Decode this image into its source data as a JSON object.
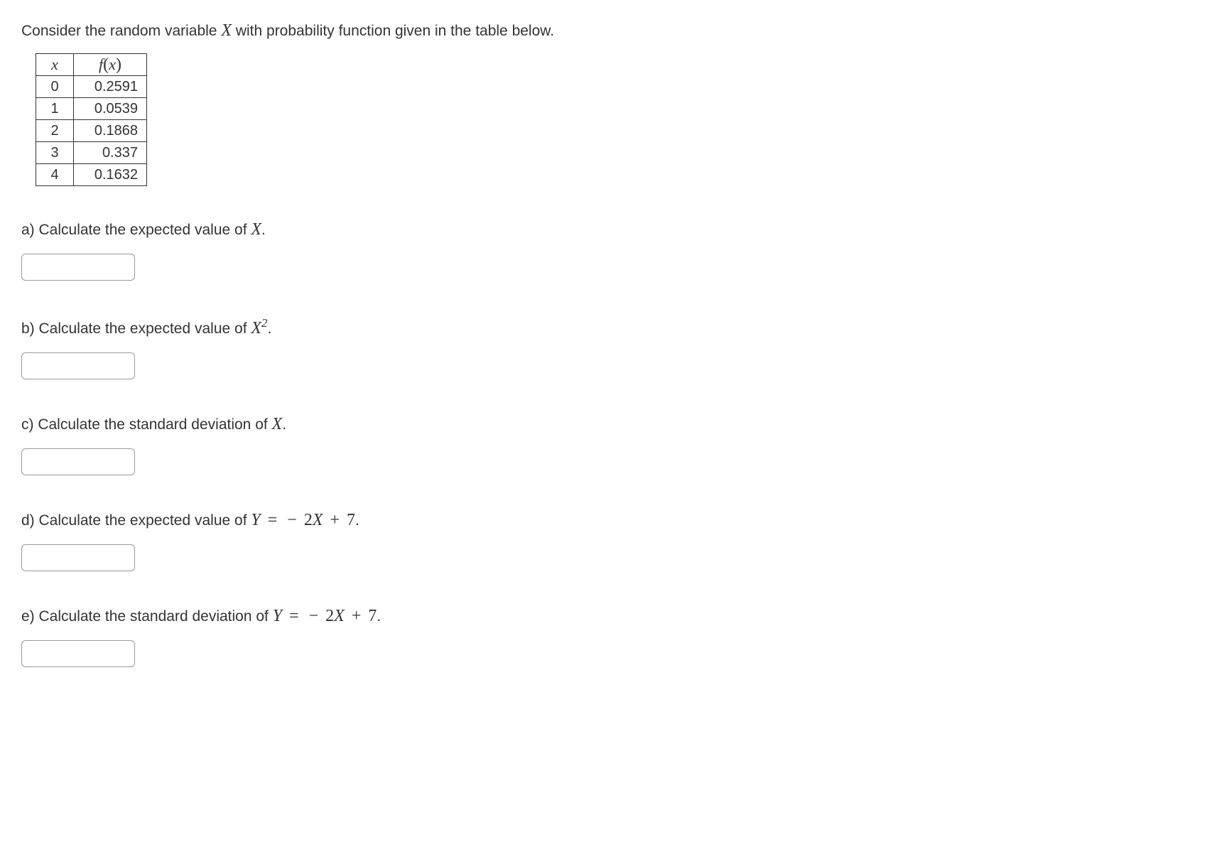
{
  "intro": {
    "prefix": "Consider the random variable ",
    "varX": "X",
    "suffix": " with probability function given in the table below."
  },
  "table": {
    "header_x": "x",
    "header_fx_f": "f",
    "header_fx_paren_open": "(",
    "header_fx_x": "x",
    "header_fx_paren_close": ")",
    "rows": [
      {
        "x": "0",
        "fx": "0.2591"
      },
      {
        "x": "1",
        "fx": "0.0539"
      },
      {
        "x": "2",
        "fx": "0.1868"
      },
      {
        "x": "3",
        "fx": "0.337"
      },
      {
        "x": "4",
        "fx": "0.1632"
      }
    ]
  },
  "questions": {
    "a": {
      "label": "a) Calculate the expected value of ",
      "var": "X",
      "suffix": "."
    },
    "b": {
      "label": "b) Calculate the expected value of ",
      "var": "X",
      "sup": "2",
      "suffix": "."
    },
    "c": {
      "label": "c) Calculate the standard deviation of ",
      "var": "X",
      "suffix": "."
    },
    "d": {
      "label": "d) Calculate the expected value of ",
      "var": "Y",
      "eq": " = ",
      "neg": " − ",
      "coef": "2",
      "var2": "X",
      "plus": " + ",
      "const": "7",
      "suffix": "."
    },
    "e": {
      "label": "e) Calculate the standard deviation of ",
      "var": "Y",
      "eq": " = ",
      "neg": " − ",
      "coef": "2",
      "var2": "X",
      "plus": " + ",
      "const": "7",
      "suffix": "."
    }
  },
  "inputs": {
    "a": "",
    "b": "",
    "c": "",
    "d": "",
    "e": ""
  }
}
